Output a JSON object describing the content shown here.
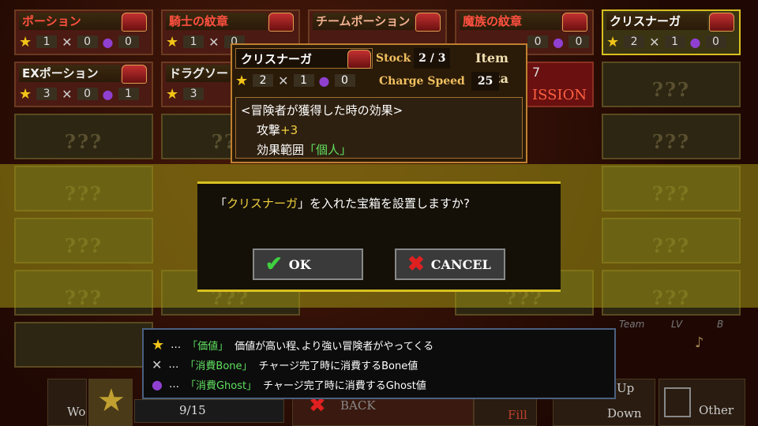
{
  "grid": {
    "row1": [
      {
        "name": "ポーション",
        "title_color": "red",
        "stars": "1",
        "bone": "0",
        "ghost": "0"
      },
      {
        "name": "騎士の紋章",
        "title_color": "red",
        "stars": "1",
        "bone": "0",
        "ghost": "0"
      },
      {
        "name": "チームポーション",
        "title_color": "normal",
        "stars": "",
        "bone": "",
        "ghost": ""
      },
      {
        "name": "魔族の紋章",
        "title_color": "red",
        "stars": "",
        "bone": "0",
        "ghost": "0"
      },
      {
        "name": "クリスナーガ",
        "title_color": "normal",
        "stars": "2",
        "bone": "1",
        "ghost": "0"
      }
    ],
    "row2": [
      {
        "name": "EXポーション",
        "stars": "3",
        "bone": "0",
        "ghost": "1"
      },
      {
        "name": "ドラグソー",
        "stars": "3",
        "bone": "",
        "ghost": ""
      }
    ],
    "unknown": "???",
    "mission_fragment": "ISSION",
    "number_fragment": "7"
  },
  "item_panel": {
    "name": "クリスナーガ",
    "stock_label": "Stock",
    "stock_value": "2 / 3",
    "header": "Item Data",
    "stars": "2",
    "bone": "1",
    "ghost": "0",
    "charge_label": "Charge Speed",
    "charge_value": "25",
    "effect_title": "<冒険者が獲得した時の効果>",
    "effect_stat": "攻撃",
    "effect_stat_value": "+3",
    "effect_range_label": "効果範囲",
    "effect_range_value": "「個人」"
  },
  "dialog": {
    "message_prefix": "「",
    "message_item": "クリスナーガ",
    "message_suffix": "」を入れた宝箱を設置しますか?",
    "ok_label": "OK",
    "cancel_label": "CANCEL"
  },
  "legend": {
    "rows": [
      {
        "dots": "…",
        "label": "「価値」",
        "desc": "価値が高い程､より強い冒険者がやってくる"
      },
      {
        "dots": "…",
        "label": "「消費Bone」",
        "desc": "チャージ完了時に消費するBone値"
      },
      {
        "dots": "…",
        "label": "「消費Ghost」",
        "desc": "チャージ完了時に消費するGhost値"
      }
    ]
  },
  "bottom": {
    "counter": "9/15",
    "wo": "Wo",
    "back": "BACK",
    "fill": "Fill",
    "up": "Up",
    "down": "Down",
    "other": "Other",
    "team": "Team",
    "lv": "LV",
    "b": "B"
  }
}
